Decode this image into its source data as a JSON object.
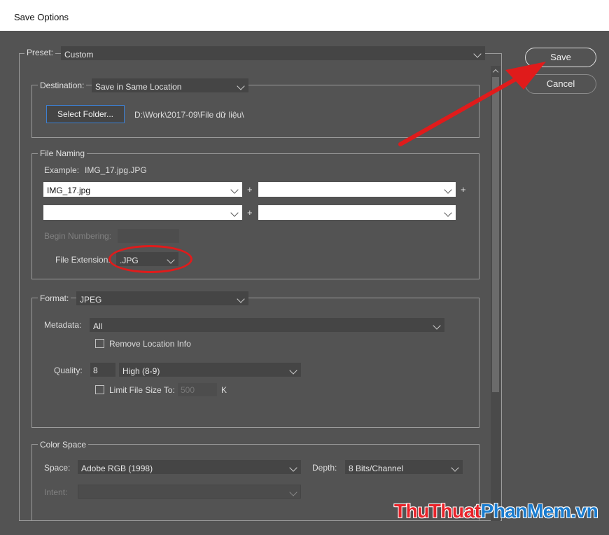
{
  "window": {
    "title": "Save Options"
  },
  "preset": {
    "label": "Preset:",
    "value": "Custom"
  },
  "buttons": {
    "save": "Save",
    "cancel": "Cancel"
  },
  "destination": {
    "label": "Destination:",
    "value": "Save in Same Location",
    "select_folder_button": "Select Folder...",
    "path": "D:\\Work\\2017-09\\File dữ liệu\\"
  },
  "file_naming": {
    "title": "File Naming",
    "example_label": "Example:",
    "example_value": "IMG_17.jpg.JPG",
    "fields": [
      "IMG_17.jpg",
      "",
      "",
      ""
    ],
    "plus": "+",
    "begin_numbering_label": "Begin Numbering:",
    "file_extension_label": "File Extension:",
    "file_extension_value": ".JPG"
  },
  "format": {
    "label": "Format:",
    "value": "JPEG",
    "metadata_label": "Metadata:",
    "metadata_value": "All",
    "remove_location_label": "Remove Location Info",
    "quality_label": "Quality:",
    "quality_value": "8",
    "quality_select": "High  (8-9)",
    "limit_size_label": "Limit File Size To:",
    "limit_size_value": "500",
    "limit_size_unit": "K"
  },
  "color_space": {
    "title": "Color Space",
    "space_label": "Space:",
    "space_value": "Adobe RGB (1998)",
    "depth_label": "Depth:",
    "depth_value": "8 Bits/Channel",
    "intent_label": "Intent:",
    "intent_value": ""
  },
  "watermark": {
    "text": "ThuThuatPhanMem.vn",
    "colors": {
      "thu": "#e8232a",
      "phan": "#1a7ccf"
    }
  },
  "colors": {
    "annotation_red": "#e01b1b",
    "panel_bg": "#535353",
    "field_bg": "#454545"
  }
}
